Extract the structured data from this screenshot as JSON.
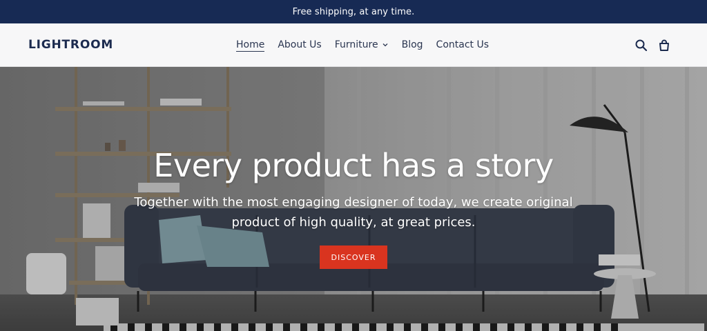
{
  "announcement": {
    "text": "Free shipping, at any time."
  },
  "header": {
    "logo": "LIGHTROOM",
    "nav": [
      {
        "label": "Home",
        "active": true
      },
      {
        "label": "About Us"
      },
      {
        "label": "Furniture",
        "has_dropdown": true
      },
      {
        "label": "Blog"
      },
      {
        "label": "Contact Us"
      }
    ],
    "icons": [
      "search-icon",
      "cart-icon"
    ]
  },
  "hero": {
    "title": "Every product has a story",
    "subtitle": "Together with the most engaging designer of today, we create original product of high quality, at great prices.",
    "button_label": "DISCOVER"
  },
  "colors": {
    "announcement_bg": "#172a54",
    "header_bg": "#f7f7f8",
    "brand_text": "#1c2b4f",
    "button_bg": "#d9341f"
  }
}
